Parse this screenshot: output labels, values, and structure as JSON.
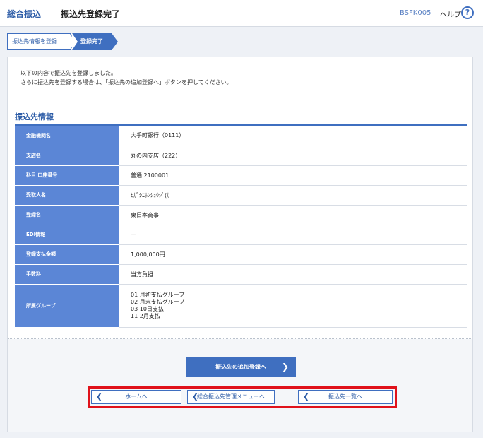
{
  "header": {
    "service": "総合振込",
    "title": "振込先登録完了",
    "screen_code": "BSFK005",
    "help_label": "ヘルプ",
    "help_icon": "?"
  },
  "steps": [
    {
      "label": "振込先情報を登録"
    },
    {
      "label": "登録完了"
    }
  ],
  "message": {
    "line1": "以下の内容で振込先を登録しました。",
    "line2": "さらに振込先を登録する場合は、「振込先の追加登録へ」ボタンを押してください。"
  },
  "section": {
    "title": "振込先情報"
  },
  "rows": [
    {
      "label": "金融機関名",
      "value": "大手町銀行（0111）"
    },
    {
      "label": "支店名",
      "value": "丸の内支店（222）"
    },
    {
      "label": "科目 口座番号",
      "value": "普通 2100001"
    },
    {
      "label": "受取人名",
      "value": "ﾋｶﾞｼﾆﾎﾝｼｮｳｼﾞ(ｶ"
    },
    {
      "label": "登録名",
      "value": "東日本商事"
    },
    {
      "label": "EDI情報",
      "value": "－"
    },
    {
      "label": "登録支払金額",
      "value": "1,000,000円"
    },
    {
      "label": "手数料",
      "value": "当方負担"
    }
  ],
  "group_row": {
    "label": "所属グループ",
    "values": [
      "01 月初支払グループ",
      "02 月末支払グループ",
      "03 10日支払",
      "11 2月支払"
    ]
  },
  "buttons": {
    "add": "振込先の追加登録へ",
    "home": "ホームへ",
    "menu": "総合振込先管理メニューへ",
    "list": "振込先一覧へ",
    "chev_right": "❯",
    "chev_left": "❮"
  },
  "colors": {
    "accent": "#3f6fc0",
    "header_cell": "#5b86d6",
    "highlight": "#e0121b"
  }
}
